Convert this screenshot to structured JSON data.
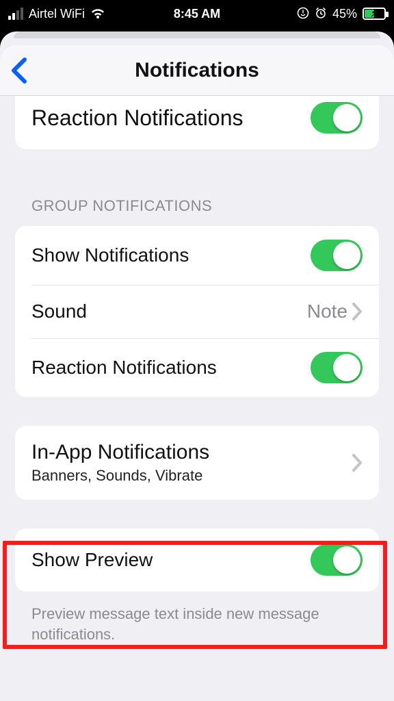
{
  "status_bar": {
    "carrier": "Airtel WiFi",
    "time": "8:45 AM",
    "battery_percent": "45%"
  },
  "nav": {
    "title": "Notifications"
  },
  "partial_top_row": {
    "label": "Reaction Notifications",
    "toggle_on": true
  },
  "group_header": "GROUP NOTIFICATIONS",
  "group_rows": {
    "show_notifications": {
      "label": "Show Notifications",
      "toggle_on": true
    },
    "sound": {
      "label": "Sound",
      "value": "Note"
    },
    "reaction": {
      "label": "Reaction Notifications",
      "toggle_on": true
    }
  },
  "in_app": {
    "label": "In-App Notifications",
    "sublabel": "Banners, Sounds, Vibrate"
  },
  "show_preview": {
    "label": "Show Preview",
    "toggle_on": true
  },
  "footer_note": "Preview message text inside new message notifications."
}
